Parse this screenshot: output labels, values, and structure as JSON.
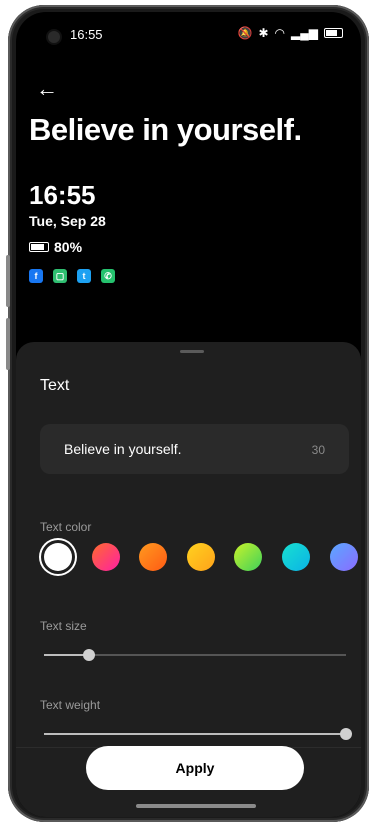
{
  "status_bar": {
    "time": "16:55",
    "icons": [
      "mute-icon",
      "bluetooth-icon",
      "wifi-icon",
      "signal-icon",
      "battery-icon"
    ]
  },
  "preview": {
    "back_icon": "arrow-left-icon",
    "headline": "Believe in yourself.",
    "clock": "16:55",
    "date": "Tue, Sep 28",
    "battery_percent": "80%",
    "app_icons": [
      "facebook-icon",
      "messages-icon",
      "twitter-icon",
      "phone-icon"
    ]
  },
  "sheet": {
    "title": "Text",
    "text_field": {
      "value": "Believe in yourself.",
      "char_count": "30"
    },
    "text_color_label": "Text color",
    "color_swatches": [
      {
        "name": "white",
        "color": "#ffffff",
        "selected": true
      },
      {
        "name": "pink",
        "color": "#ff3d8b"
      },
      {
        "name": "orange",
        "color": "#ff7a18"
      },
      {
        "name": "yellow",
        "color": "#ffc21a"
      },
      {
        "name": "lime",
        "color": "#8fe12a"
      },
      {
        "name": "cyan",
        "color": "#10d0d8"
      },
      {
        "name": "blue",
        "color": "#6e8bff"
      }
    ],
    "text_size_label": "Text size",
    "text_size_value": 0.15,
    "text_weight_label": "Text weight",
    "text_weight_value": 1.0
  },
  "apply_button": "Apply",
  "colors": {
    "screen_bg": "#000000",
    "sheet_bg": "#1f1f1f",
    "field_bg": "#2a2a2a"
  }
}
